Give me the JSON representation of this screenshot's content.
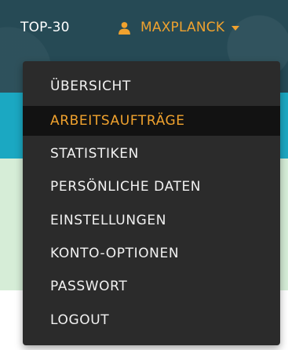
{
  "nav": {
    "top30_label": "TOP-30",
    "user_label": "MAXPLANCK",
    "user_icon": "user-icon",
    "caret_icon": "caret-down-icon"
  },
  "dropdown": {
    "items": [
      {
        "label": "ÜBERSICHT",
        "active": false
      },
      {
        "label": "ARBEITSAUFTRÄGE",
        "active": true
      },
      {
        "label": "STATISTIKEN",
        "active": false
      },
      {
        "label": "PERSÖNLICHE DATEN",
        "active": false
      },
      {
        "label": "EINSTELLUNGEN",
        "active": false
      },
      {
        "label": "KONTO-OPTIONEN",
        "active": false
      },
      {
        "label": "PASSWORT",
        "active": false
      },
      {
        "label": "LOGOUT",
        "active": false
      }
    ]
  },
  "colors": {
    "topbar": "#264a55",
    "accent": "#f0a22e",
    "teal_band": "#1ba8c2",
    "green_band": "#d6edd7",
    "menu_bg": "#2b2b2b",
    "menu_active_bg": "#121212"
  }
}
